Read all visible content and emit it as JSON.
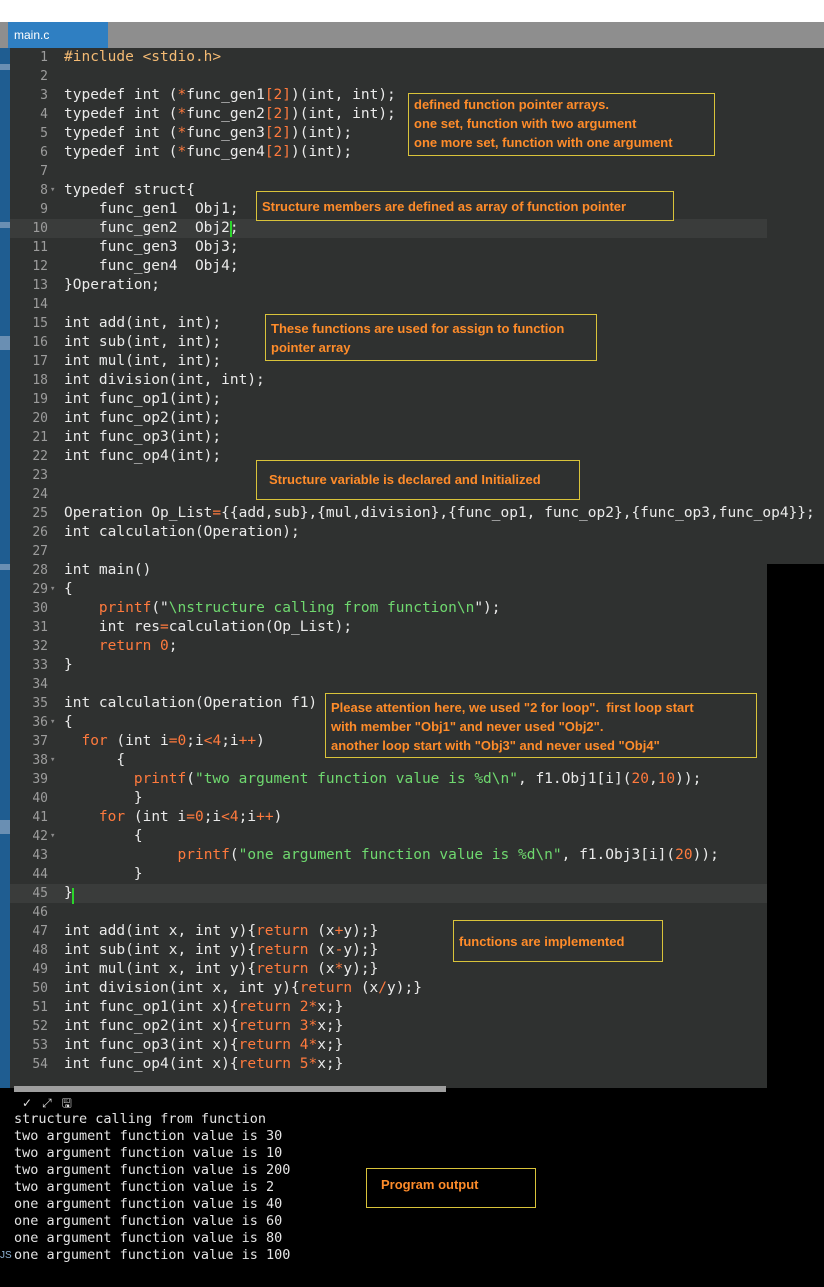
{
  "tab": {
    "label": "main.c"
  },
  "editor": {
    "lines": [
      {
        "n": "1",
        "fold": "",
        "segs": [
          [
            "pre",
            "#include <stdio.h>"
          ]
        ]
      },
      {
        "n": "2",
        "fold": "",
        "segs": []
      },
      {
        "n": "3",
        "fold": "",
        "segs": [
          [
            "norm",
            "typedef int ("
          ],
          [
            "op",
            "*"
          ],
          [
            "norm",
            "func_gen1"
          ],
          [
            "op",
            "[2]"
          ],
          [
            "norm",
            ")(int, int);"
          ]
        ]
      },
      {
        "n": "4",
        "fold": "",
        "segs": [
          [
            "norm",
            "typedef int ("
          ],
          [
            "op",
            "*"
          ],
          [
            "norm",
            "func_gen2"
          ],
          [
            "op",
            "[2]"
          ],
          [
            "norm",
            ")(int, int);"
          ]
        ]
      },
      {
        "n": "5",
        "fold": "",
        "segs": [
          [
            "norm",
            "typedef int ("
          ],
          [
            "op",
            "*"
          ],
          [
            "norm",
            "func_gen3"
          ],
          [
            "op",
            "[2]"
          ],
          [
            "norm",
            ")(int);"
          ]
        ]
      },
      {
        "n": "6",
        "fold": "",
        "segs": [
          [
            "norm",
            "typedef int ("
          ],
          [
            "op",
            "*"
          ],
          [
            "norm",
            "func_gen4"
          ],
          [
            "op",
            "[2]"
          ],
          [
            "norm",
            ")(int);"
          ]
        ]
      },
      {
        "n": "7",
        "fold": "",
        "segs": []
      },
      {
        "n": "8",
        "fold": "▾",
        "segs": [
          [
            "norm",
            "typedef struct{"
          ]
        ]
      },
      {
        "n": "9",
        "fold": "",
        "segs": [
          [
            "norm",
            "    func_gen1  Obj1;"
          ]
        ]
      },
      {
        "n": "10",
        "fold": "",
        "segs": [
          [
            "norm",
            "    func_gen2  Obj2;"
          ]
        ]
      },
      {
        "n": "11",
        "fold": "",
        "segs": [
          [
            "norm",
            "    func_gen3  Obj3;"
          ]
        ]
      },
      {
        "n": "12",
        "fold": "",
        "segs": [
          [
            "norm",
            "    func_gen4  Obj4;"
          ]
        ]
      },
      {
        "n": "13",
        "fold": "",
        "segs": [
          [
            "norm",
            "}Operation;"
          ]
        ]
      },
      {
        "n": "14",
        "fold": "",
        "segs": []
      },
      {
        "n": "15",
        "fold": "",
        "segs": [
          [
            "norm",
            "int add(int, int);"
          ]
        ]
      },
      {
        "n": "16",
        "fold": "",
        "segs": [
          [
            "norm",
            "int sub(int, int);"
          ]
        ]
      },
      {
        "n": "17",
        "fold": "",
        "segs": [
          [
            "norm",
            "int mul(int, int);"
          ]
        ]
      },
      {
        "n": "18",
        "fold": "",
        "segs": [
          [
            "norm",
            "int division(int, int);"
          ]
        ]
      },
      {
        "n": "19",
        "fold": "",
        "segs": [
          [
            "norm",
            "int func_op1(int);"
          ]
        ]
      },
      {
        "n": "20",
        "fold": "",
        "segs": [
          [
            "norm",
            "int func_op2(int);"
          ]
        ]
      },
      {
        "n": "21",
        "fold": "",
        "segs": [
          [
            "norm",
            "int func_op3(int);"
          ]
        ]
      },
      {
        "n": "22",
        "fold": "",
        "segs": [
          [
            "norm",
            "int func_op4(int);"
          ]
        ]
      },
      {
        "n": "23",
        "fold": "",
        "segs": []
      },
      {
        "n": "24",
        "fold": "",
        "segs": []
      },
      {
        "n": "25",
        "fold": "",
        "segs": [
          [
            "norm",
            "Operation Op_List"
          ],
          [
            "op",
            "="
          ],
          [
            "norm",
            "{{add,sub},{mul,division},{func_op1, func_op2},{func_op3,func_op4}};"
          ]
        ]
      },
      {
        "n": "26",
        "fold": "",
        "segs": [
          [
            "norm",
            "int calculation(Operation);"
          ]
        ]
      },
      {
        "n": "27",
        "fold": "",
        "segs": []
      },
      {
        "n": "28",
        "fold": "",
        "segs": [
          [
            "norm",
            "int main()"
          ]
        ]
      },
      {
        "n": "29",
        "fold": "▾",
        "segs": [
          [
            "norm",
            "{"
          ]
        ]
      },
      {
        "n": "30",
        "fold": "",
        "segs": [
          [
            "norm",
            "    "
          ],
          [
            "kw",
            "printf"
          ],
          [
            "norm",
            "(\""
          ],
          [
            "str",
            "\\nstructure calling from function\\n"
          ],
          [
            "norm",
            "\");"
          ]
        ]
      },
      {
        "n": "31",
        "fold": "",
        "segs": [
          [
            "norm",
            "    int res"
          ],
          [
            "op",
            "="
          ],
          [
            "norm",
            "calculation(Op_List);"
          ]
        ]
      },
      {
        "n": "32",
        "fold": "",
        "segs": [
          [
            "norm",
            "    "
          ],
          [
            "kw",
            "return"
          ],
          [
            "norm",
            " "
          ],
          [
            "num",
            "0"
          ],
          [
            "norm",
            ";"
          ]
        ]
      },
      {
        "n": "33",
        "fold": "",
        "segs": [
          [
            "norm",
            "}"
          ]
        ]
      },
      {
        "n": "34",
        "fold": "",
        "segs": []
      },
      {
        "n": "35",
        "fold": "",
        "segs": [
          [
            "norm",
            "int calculation(Operation f1)"
          ]
        ]
      },
      {
        "n": "36",
        "fold": "▾",
        "segs": [
          [
            "norm",
            "{"
          ]
        ]
      },
      {
        "n": "37",
        "fold": "",
        "segs": [
          [
            "norm",
            "  "
          ],
          [
            "kw",
            "for"
          ],
          [
            "norm",
            " (int i"
          ],
          [
            "op",
            "="
          ],
          [
            "num",
            "0"
          ],
          [
            "norm",
            ";i"
          ],
          [
            "op",
            "<"
          ],
          [
            "num",
            "4"
          ],
          [
            "norm",
            ";i"
          ],
          [
            "op",
            "++"
          ],
          [
            "norm",
            ")"
          ]
        ]
      },
      {
        "n": "38",
        "fold": "▾",
        "segs": [
          [
            "norm",
            "      {"
          ]
        ]
      },
      {
        "n": "39",
        "fold": "",
        "segs": [
          [
            "norm",
            "        "
          ],
          [
            "kw",
            "printf"
          ],
          [
            "norm",
            "("
          ],
          [
            "str",
            "\"two argument function value is %d\\n\""
          ],
          [
            "norm",
            ", f1.Obj1[i]("
          ],
          [
            "num",
            "20"
          ],
          [
            "norm",
            ","
          ],
          [
            "num",
            "10"
          ],
          [
            "norm",
            "));"
          ]
        ]
      },
      {
        "n": "40",
        "fold": "",
        "segs": [
          [
            "norm",
            "        }"
          ]
        ]
      },
      {
        "n": "41",
        "fold": "",
        "segs": [
          [
            "norm",
            "    "
          ],
          [
            "kw",
            "for"
          ],
          [
            "norm",
            " (int i"
          ],
          [
            "op",
            "="
          ],
          [
            "num",
            "0"
          ],
          [
            "norm",
            ";i"
          ],
          [
            "op",
            "<"
          ],
          [
            "num",
            "4"
          ],
          [
            "norm",
            ";i"
          ],
          [
            "op",
            "++"
          ],
          [
            "norm",
            ")"
          ]
        ]
      },
      {
        "n": "42",
        "fold": "▾",
        "segs": [
          [
            "norm",
            "        {"
          ]
        ]
      },
      {
        "n": "43",
        "fold": "",
        "segs": [
          [
            "norm",
            "             "
          ],
          [
            "kw",
            "printf"
          ],
          [
            "norm",
            "("
          ],
          [
            "str",
            "\"one argument function value is %d\\n\""
          ],
          [
            "norm",
            ", f1.Obj3[i]("
          ],
          [
            "num",
            "20"
          ],
          [
            "norm",
            "));"
          ]
        ]
      },
      {
        "n": "44",
        "fold": "",
        "segs": [
          [
            "norm",
            "        }"
          ]
        ]
      },
      {
        "n": "45",
        "fold": "",
        "segs": [
          [
            "norm",
            "}"
          ]
        ]
      },
      {
        "n": "46",
        "fold": "",
        "segs": []
      },
      {
        "n": "47",
        "fold": "",
        "segs": [
          [
            "norm",
            "int add(int x, int y){"
          ],
          [
            "kw",
            "return"
          ],
          [
            "norm",
            " (x"
          ],
          [
            "op",
            "+"
          ],
          [
            "norm",
            "y);}"
          ]
        ]
      },
      {
        "n": "48",
        "fold": "",
        "segs": [
          [
            "norm",
            "int sub(int x, int y){"
          ],
          [
            "kw",
            "return"
          ],
          [
            "norm",
            " (x"
          ],
          [
            "op",
            "-"
          ],
          [
            "norm",
            "y);}"
          ]
        ]
      },
      {
        "n": "49",
        "fold": "",
        "segs": [
          [
            "norm",
            "int mul(int x, int y){"
          ],
          [
            "kw",
            "return"
          ],
          [
            "norm",
            " (x"
          ],
          [
            "op",
            "*"
          ],
          [
            "norm",
            "y);}"
          ]
        ]
      },
      {
        "n": "50",
        "fold": "",
        "segs": [
          [
            "norm",
            "int division(int x, int y){"
          ],
          [
            "kw",
            "return"
          ],
          [
            "norm",
            " (x"
          ],
          [
            "op",
            "/"
          ],
          [
            "norm",
            "y);}"
          ]
        ]
      },
      {
        "n": "51",
        "fold": "",
        "segs": [
          [
            "norm",
            "int func_op1(int x){"
          ],
          [
            "kw",
            "return"
          ],
          [
            "norm",
            " "
          ],
          [
            "num",
            "2"
          ],
          [
            "op",
            "*"
          ],
          [
            "norm",
            "x;}"
          ]
        ]
      },
      {
        "n": "52",
        "fold": "",
        "segs": [
          [
            "norm",
            "int func_op2(int x){"
          ],
          [
            "kw",
            "return"
          ],
          [
            "norm",
            " "
          ],
          [
            "num",
            "3"
          ],
          [
            "op",
            "*"
          ],
          [
            "norm",
            "x;}"
          ]
        ]
      },
      {
        "n": "53",
        "fold": "",
        "segs": [
          [
            "norm",
            "int func_op3(int x){"
          ],
          [
            "kw",
            "return"
          ],
          [
            "norm",
            " "
          ],
          [
            "num",
            "4"
          ],
          [
            "op",
            "*"
          ],
          [
            "norm",
            "x;}"
          ]
        ]
      },
      {
        "n": "54",
        "fold": "",
        "segs": [
          [
            "norm",
            "int func_op4(int x){"
          ],
          [
            "kw",
            "return"
          ],
          [
            "norm",
            " "
          ],
          [
            "num",
            "5"
          ],
          [
            "op",
            "*"
          ],
          [
            "norm",
            "x;}"
          ]
        ]
      }
    ]
  },
  "notes": {
    "fp_arrays": "defined function pointer arrays.\none set, function with two argument\none more set, function with one argument",
    "struct_members": "Structure members are defined as array of function pointer",
    "functions_used": "These functions are used for assign to function\npointer array",
    "struct_var": "Structure variable is declared and Initialized",
    "attention": "Please attention here, we used \"2 for loop\".  first loop start\nwith member \"Obj1\" and never used \"Obj2\".\nanother loop start with \"Obj3\" and never used \"Obj4\"",
    "implemented": "functions are implemented"
  },
  "terminal": {
    "icons": [
      "check-icon",
      "resize-icon",
      "save-icon"
    ],
    "icon_glyphs": "✓ ⤢ 🖫",
    "lines": [
      "structure calling from function",
      "two argument function value is 30",
      "two argument function value is 10",
      "two argument function value is 200",
      "two argument function value is 2",
      "one argument function value is 40",
      "one argument function value is 60",
      "one argument function value is 80",
      "one argument function value is 100"
    ],
    "note": "Program output",
    "left_label": "JS"
  }
}
